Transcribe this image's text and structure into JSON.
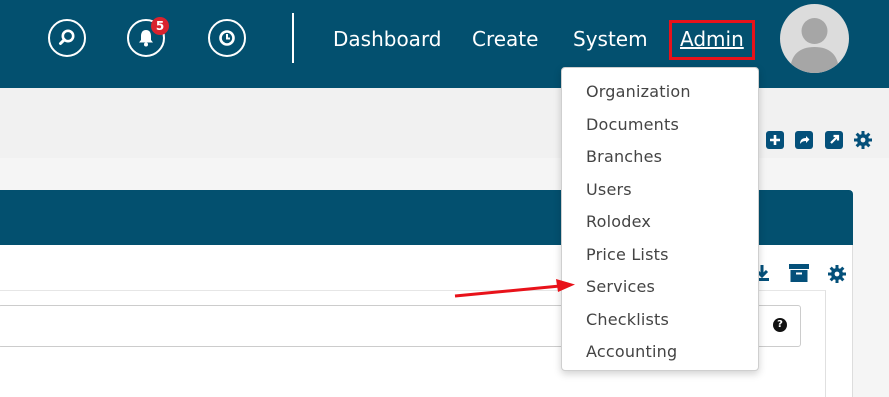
{
  "header": {
    "notifications_count": "5",
    "nav": {
      "dashboard": "Dashboard",
      "create": "Create",
      "system": "System",
      "admin": "Admin"
    }
  },
  "admin_menu": {
    "items": [
      "Organization",
      "Documents",
      "Branches",
      "Users",
      "Rolodex",
      "Price Lists",
      "Services",
      "Checklists",
      "Accounting"
    ]
  },
  "icons": {
    "search": "search-icon",
    "bell": "bell-icon",
    "history": "clock-icon",
    "avatar": "user-avatar-icon",
    "toolbar": [
      "plus-square-icon",
      "share-square-icon",
      "external-link-icon",
      "gear-icon"
    ],
    "panel_tools": [
      "download-icon",
      "archive-icon",
      "gear-icon"
    ],
    "help": "question-circle-icon"
  },
  "colors": {
    "header_bg": "#03506f",
    "highlight": "#e8121a",
    "badge": "#d9232e",
    "icon_blue": "#04507a"
  }
}
